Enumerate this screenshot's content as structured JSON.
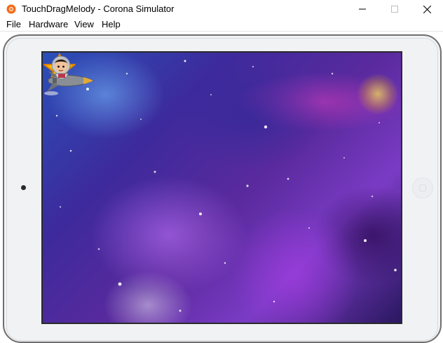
{
  "window": {
    "title": "TouchDragMelody - Corona Simulator",
    "app_icon": "corona-icon",
    "controls": [
      "minimize-icon",
      "maximize-icon",
      "close-icon"
    ]
  },
  "menubar": {
    "items": [
      "File",
      "Hardware",
      "View",
      "Help"
    ]
  },
  "device": {
    "type": "tablet",
    "camera_icon": "camera-dot",
    "home_button_icon": "home-button-icon"
  },
  "game": {
    "background": "space-nebula",
    "sprites": [
      "star-icon",
      "rocket-character-icon"
    ]
  },
  "colors": {
    "star": "#f5b800",
    "device_bezel": "#f1f2f4",
    "device_border": "#6f6f6f"
  }
}
